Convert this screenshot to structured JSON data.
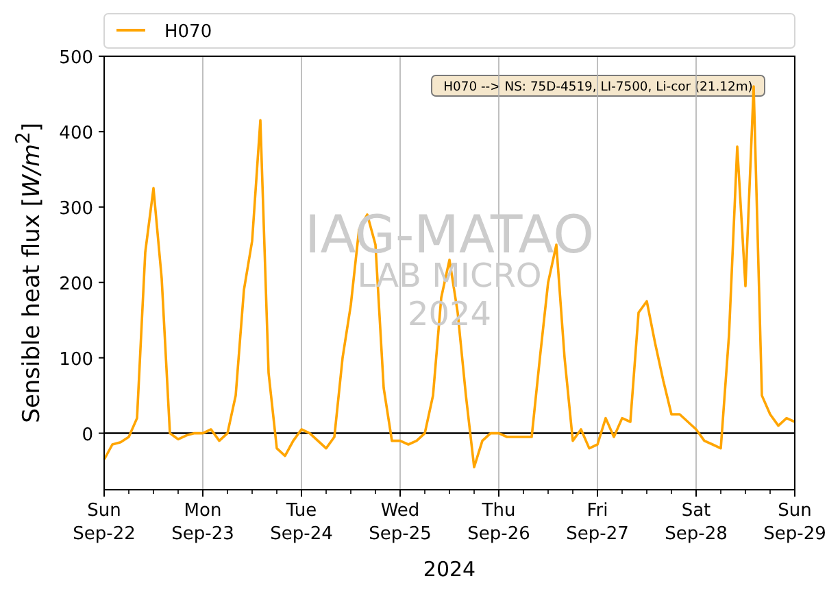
{
  "figure": {
    "annotation": "H070 --> NS: 75D-4519, LI-7500, Li-cor (21.12m)",
    "watermark": [
      "IAG-MATAO",
      "LAB MICRO",
      "2024"
    ],
    "chart_data": {
      "type": "line",
      "xlabel": "2024",
      "ylabel": "Sensible heat flux [*W/m*$^{2}$]",
      "categories": [
        "Sun\nSep-22",
        null,
        null,
        null,
        null,
        null,
        null,
        null,
        null,
        null,
        null,
        null,
        "Mon\nSep-23",
        null,
        null,
        null,
        null,
        null,
        null,
        null,
        null,
        null,
        null,
        null,
        "Tue\nSep-24",
        null,
        null,
        null,
        null,
        null,
        null,
        null,
        null,
        null,
        null,
        null,
        "Wed\nSep-25",
        null,
        null,
        null,
        null,
        null,
        null,
        null,
        null,
        null,
        null,
        null,
        "Thu\nSep-26",
        null,
        null,
        null,
        null,
        null,
        null,
        null,
        null,
        null,
        null,
        null,
        "Fri\nSep-27",
        null,
        null,
        null,
        null,
        null,
        null,
        null,
        null,
        null,
        null,
        null,
        "Sat\nSep-28",
        null,
        null,
        null,
        null,
        null,
        null,
        null,
        null,
        null,
        null,
        null,
        "Sun\nSep-29"
      ],
      "series": [
        {
          "name": "H070",
          "color": "#ffa500",
          "values": [
            -35,
            -15,
            -12,
            -5,
            20,
            240,
            325,
            205,
            0,
            -8,
            -3,
            0,
            0,
            5,
            -10,
            0,
            50,
            190,
            255,
            415,
            80,
            -20,
            -30,
            -10,
            5,
            0,
            -10,
            -20,
            -5,
            100,
            170,
            270,
            290,
            250,
            60,
            -10,
            -10,
            -15,
            -10,
            0,
            50,
            180,
            230,
            160,
            50,
            -45,
            -10,
            0,
            0,
            -5,
            -5,
            -5,
            -5,
            100,
            200,
            250,
            100,
            -10,
            5,
            -20,
            -15,
            20,
            -5,
            20,
            15,
            160,
            175,
            120,
            70,
            25,
            25,
            15,
            5,
            -10,
            -15,
            -20,
            130,
            380,
            195,
            460,
            50,
            25,
            10,
            20,
            15
          ]
        }
      ],
      "ylim": [
        -75,
        500
      ],
      "grid": "x",
      "yticks": [
        0,
        100,
        200,
        300,
        400,
        500
      ]
    }
  }
}
